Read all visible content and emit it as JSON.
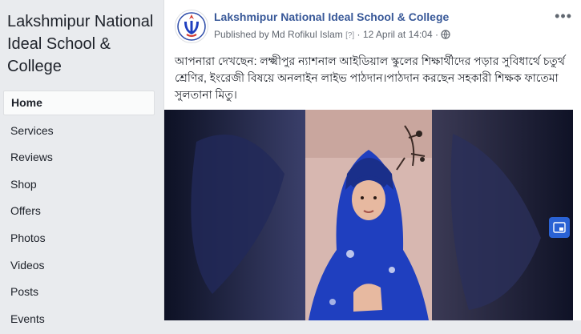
{
  "sidebar": {
    "page_name": "Lakshmipur National Ideal School & College",
    "nav": [
      "Home",
      "Services",
      "Reviews",
      "Shop",
      "Offers",
      "Photos",
      "Videos",
      "Posts",
      "Events"
    ],
    "active": "Home"
  },
  "post": {
    "title": "Lakshmipur National Ideal School & College",
    "published_by": "Published by Md Rofikul Islam",
    "help_mark": "[?]",
    "date": "12 April at 14:04",
    "separator": "·",
    "text": "আপনারা দেখছেন: লক্ষ্মীপুর ন্যাশনাল আইডিয়াল স্কুলের শিক্ষার্থীদের পড়ার সুবিধার্থে চতুর্থ শ্রেণির, ইংরেজী বিষয়ে অনলাইন লাইভ পাঠদান।পাঠদান করছেন সহকারী শিক্ষক ফাতেমা সুলতানা মিতু।"
  },
  "colors": {
    "link": "#385898",
    "background": "#e9ebee",
    "video_dark": "#1a2040",
    "dress_blue": "#1f3fbf"
  },
  "icons": [
    "school-logo-icon",
    "more-options-icon",
    "globe-icon",
    "pip-icon"
  ]
}
